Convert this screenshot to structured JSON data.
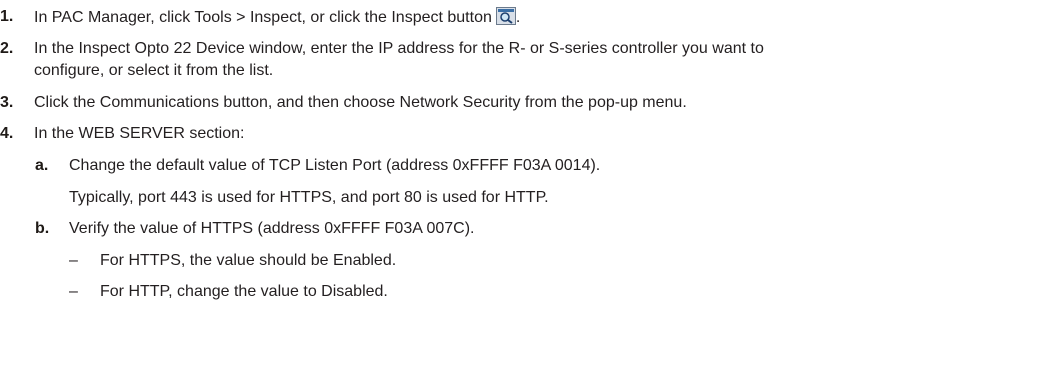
{
  "steps": [
    {
      "number": "1.",
      "text": "In PAC Manager, click Tools > Inspect, or click the Inspect button"
    },
    {
      "number": "2.",
      "text": "In the Inspect Opto 22 Device window, enter the IP address for the R- or S-series controller you want to",
      "continuation": "configure, or select it from the list."
    },
    {
      "number": "3.",
      "text": "Click the Communications button, and then choose Network Security from the pop-up menu."
    },
    {
      "number": "4.",
      "text": "In the WEB SERVER section:"
    }
  ],
  "substeps": [
    {
      "letter": "a.",
      "text": "Change the default value of TCP Listen Port (address 0xFFFF F03A 0014).",
      "note": "Typically, port 443 is used for HTTPS, and port 80 is used for HTTP."
    },
    {
      "letter": "b.",
      "text": "Verify the value of HTTPS (address 0xFFFF F03A 007C)."
    }
  ],
  "bullets": [
    {
      "marker": "–",
      "text": "For HTTPS, the value should be Enabled."
    },
    {
      "marker": "–",
      "text": "For HTTP, change the value to Disabled."
    }
  ],
  "icons": {
    "inspect": "inspect-icon"
  }
}
